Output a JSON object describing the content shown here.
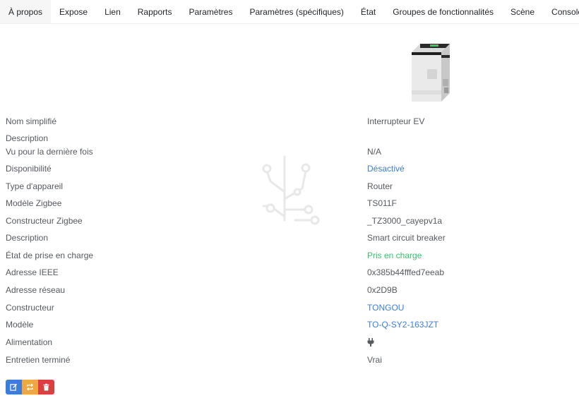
{
  "tabs": [
    {
      "label": "À propos",
      "active": true
    },
    {
      "label": "Expose"
    },
    {
      "label": "Lien"
    },
    {
      "label": "Rapports"
    },
    {
      "label": "Paramètres"
    },
    {
      "label": "Paramètres (spécifiques)"
    },
    {
      "label": "État"
    },
    {
      "label": "Groupes de fonctionnalités"
    },
    {
      "label": "Scène"
    },
    {
      "label": "Console dev"
    }
  ],
  "device": {
    "rows": [
      {
        "label": "Nom simplifié",
        "value": "Interrupteur EV"
      },
      {
        "label": "Description",
        "value": ""
      },
      {
        "label": "Vu pour la dernière fois",
        "value": "N/A"
      },
      {
        "label": "Disponibilité",
        "value": "Désactivé"
      },
      {
        "label": "Type d'appareil",
        "value": "Router"
      },
      {
        "label": "Modèle Zigbee",
        "value": "TS011F"
      },
      {
        "label": "Constructeur Zigbee",
        "value": "_TZ3000_cayepv1a"
      },
      {
        "label": "Description",
        "value": "Smart circuit breaker"
      },
      {
        "label": "État de prise en charge",
        "value": "Pris en charge"
      },
      {
        "label": "Adresse IEEE",
        "value": "0x385b44fffed7eeab"
      },
      {
        "label": "Adresse réseau",
        "value": "0x2D9B"
      },
      {
        "label": "Constructeur",
        "value": "TONGOU"
      },
      {
        "label": "Modèle",
        "value": "TO-Q-SY2-163JZT"
      },
      {
        "label": "Alimentation",
        "value": "",
        "icon": "plug-icon"
      },
      {
        "label": "Entretien terminé",
        "value": "Vrai"
      }
    ]
  },
  "colors": {
    "link": "#3b7ddd",
    "success": "#3dbb6b",
    "edit_button": "#3b7ddd",
    "rename_button": "#f0a742",
    "delete_button": "#dc3f3f"
  },
  "actions": [
    {
      "icon": "edit-icon"
    },
    {
      "icon": "rename-icon"
    },
    {
      "icon": "trash-icon"
    }
  ]
}
